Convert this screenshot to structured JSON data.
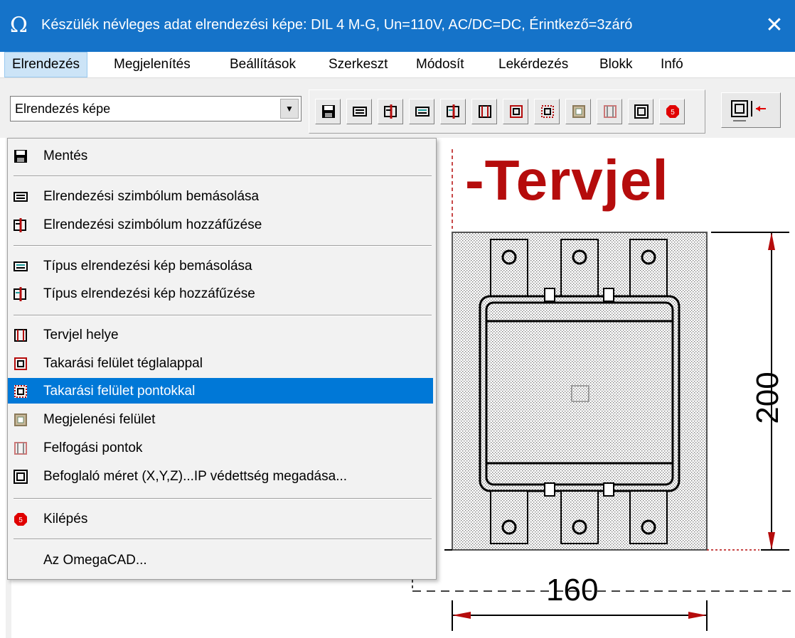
{
  "window": {
    "icon": "omega-icon",
    "title": "Készülék névleges adat elrendezési képe: DIL 4 M-G, Un=110V, AC/DC=DC, Érintkező=3záró",
    "close_glyph": "✕"
  },
  "menubar": {
    "items": [
      {
        "label": "Elrendezés"
      },
      {
        "label": "Megjelenítés"
      },
      {
        "label": "Beállítások"
      },
      {
        "label": "Szerkeszt"
      },
      {
        "label": "Módosít"
      },
      {
        "label": "Lekérdezés"
      },
      {
        "label": "Blokk"
      },
      {
        "label": "Infó"
      }
    ]
  },
  "view_select": {
    "value": "Elrendezés képe"
  },
  "toolbar": {
    "buttons": [
      "save-icon",
      "copy-symbol-icon",
      "append-symbol-icon",
      "copy-type-icon",
      "append-type-icon",
      "tervjel-icon",
      "rect-cover-icon",
      "dot-cover-icon",
      "display-area-icon",
      "grip-points-icon",
      "bounding-size-icon",
      "exit-icon"
    ],
    "right_button": "dimension-icon"
  },
  "dropdown": {
    "items": [
      {
        "label": "Mentés",
        "icon": "save-icon"
      },
      {
        "label": "Elrendezési szimbólum bemásolása",
        "icon": "copy-symbol-icon"
      },
      {
        "label": "Elrendezési szimbólum hozzáfűzése",
        "icon": "append-symbol-icon"
      },
      {
        "label": "Típus elrendezési kép bemásolása",
        "icon": "copy-type-icon"
      },
      {
        "label": "Típus elrendezési kép hozzáfűzése",
        "icon": "append-type-icon"
      },
      {
        "label": "Tervjel helye",
        "icon": "tervjel-icon"
      },
      {
        "label": "Takarási felület téglalappal",
        "icon": "rect-cover-icon"
      },
      {
        "label": "Takarási felület pontokkal",
        "icon": "dot-cover-icon",
        "selected": true
      },
      {
        "label": "Megjelenési felület",
        "icon": "display-area-icon"
      },
      {
        "label": "Felfogási pontok",
        "icon": "grip-points-icon"
      },
      {
        "label": "Befoglaló méret (X,Y,Z)...IP védettség megadása...",
        "icon": "bounding-size-icon"
      },
      {
        "label": "Kilépés",
        "icon": "exit-icon"
      },
      {
        "label": "Az OmegaCAD...",
        "icon": ""
      }
    ]
  },
  "drawing": {
    "tervjel": "-Tervjel",
    "height_dim": "200",
    "width_dim": "160",
    "accent_color": "#b50c0c"
  },
  "colors": {
    "titlebar": "#1573c9",
    "selection": "#0078d7",
    "label_red": "#b50c0c"
  }
}
